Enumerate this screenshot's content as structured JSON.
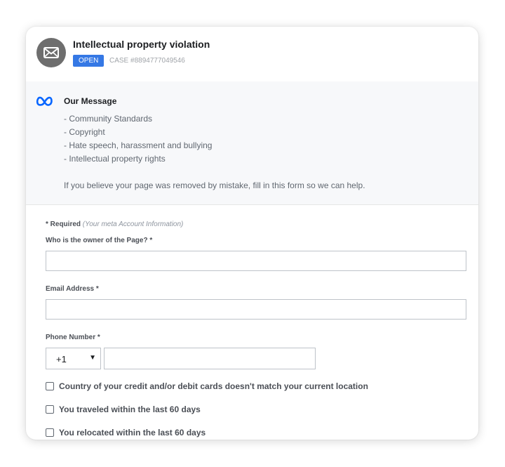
{
  "case": {
    "title": "Intellectual property violation",
    "status": "OPEN",
    "case_number": "CASE #8894777049546"
  },
  "message": {
    "heading": "Our Message",
    "items": [
      "- Community Standards",
      "- Copyright",
      "- Hate speech, harassment and bullying",
      "- Intellectual property rights"
    ],
    "footer": "If you believe your page was removed by mistake, fill in this form so we can help."
  },
  "form": {
    "required_label": "* Required",
    "required_note": "(Your meta Account Information)",
    "owner_label": "Who is the owner of the Page? *",
    "owner_value": "",
    "email_label": "Email Address *",
    "email_value": "",
    "phone_label": "Phone Number *",
    "country_code": "+1",
    "phone_value": "",
    "checkboxes": [
      {
        "label": "Country of your credit and/or debit cards doesn't match your current location",
        "checked": false
      },
      {
        "label": "You traveled within the last 60 days",
        "checked": false
      },
      {
        "label": "You relocated within the last 60 days",
        "checked": false
      }
    ]
  },
  "colors": {
    "badge": "#3578e5",
    "meta_logo": "#0866ff",
    "envelope_bg": "#6e6e6e"
  },
  "icons": {
    "header": "envelope-icon",
    "message": "meta-logo-icon",
    "select": "chevron-down-icon"
  }
}
